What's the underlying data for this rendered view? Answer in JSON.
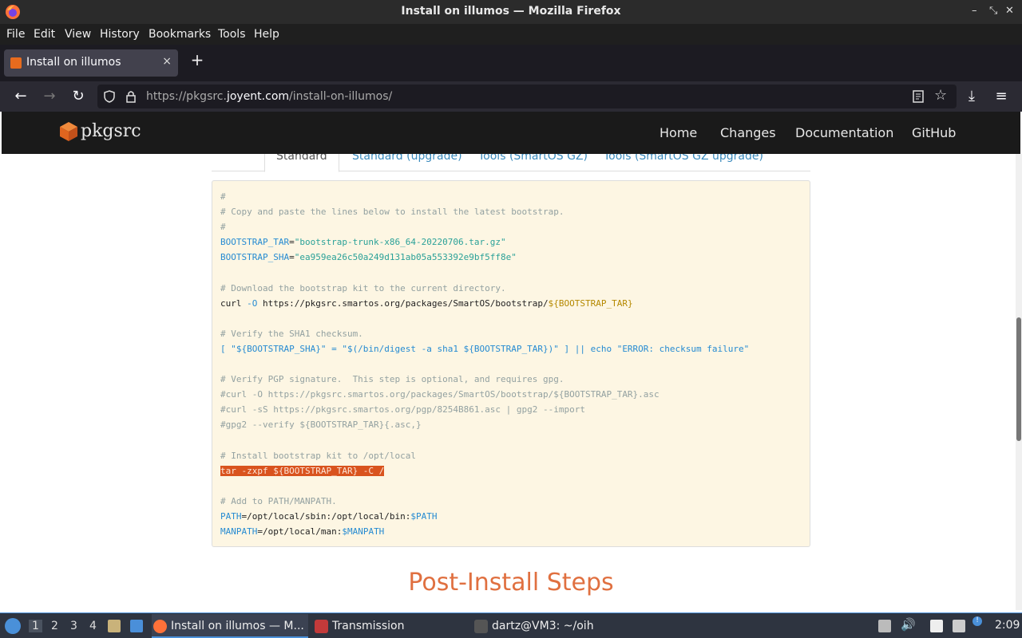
{
  "window": {
    "title": "Install on illumos — Mozilla Firefox"
  },
  "menu": [
    "File",
    "Edit",
    "View",
    "History",
    "Bookmarks",
    "Tools",
    "Help"
  ],
  "tab": {
    "label": "Install on illumos",
    "close": "×",
    "new_tab": "+"
  },
  "urlbar": {
    "prefix": "https://pkgsrc.",
    "domain": "joyent.com",
    "path": "/install-on-illumos/"
  },
  "site": {
    "logo_text": "pkgsrc",
    "nav": [
      "Home",
      "Changes",
      "Documentation",
      "GitHub"
    ]
  },
  "page_tabs": [
    "Standard",
    "Standard (upgrade)",
    "Tools (SmartOS GZ)",
    "Tools (SmartOS GZ upgrade)"
  ],
  "code": {
    "l1": "#",
    "l2": "# Copy and paste the lines below to install the latest bootstrap.",
    "l3": "#",
    "l4_var": "BOOTSTRAP_TAR",
    "l4_val": "\"bootstrap-trunk-x86_64-20220706.tar.gz\"",
    "l5_var": "BOOTSTRAP_SHA",
    "l5_val": "\"ea959ea26c50a249d131ab05a553392e9bf5ff8e\"",
    "l7": "# Download the bootstrap kit to the current directory.",
    "l8_a": "curl ",
    "l8_b": "-O",
    "l8_c": " https://pkgsrc.smartos.org/packages/SmartOS/bootstrap/",
    "l8_d": "${BOOTSTRAP_TAR}",
    "l10": "# Verify the SHA1 checksum.",
    "l11": "[ \"${BOOTSTRAP_SHA}\" = \"$(/bin/digest -a sha1 ${BOOTSTRAP_TAR})\" ] || echo \"ERROR: checksum failure\"",
    "l13": "# Verify PGP signature.  This step is optional, and requires gpg.",
    "l14": "#curl -O https://pkgsrc.smartos.org/packages/SmartOS/bootstrap/${BOOTSTRAP_TAR}.asc",
    "l15": "#curl -sS https://pkgsrc.smartos.org/pgp/8254B861.asc | gpg2 --import",
    "l16": "#gpg2 --verify ${BOOTSTRAP_TAR}{.asc,}",
    "l18": "# Install bootstrap kit to /opt/local",
    "l19": "tar -zxpf ${BOOTSTRAP_TAR} -C /",
    "l21": "# Add to PATH/MANPATH.",
    "l22_var": "PATH",
    "l22_val": "=/opt/local/sbin:/opt/local/bin:",
    "l22_end": "$PATH",
    "l23_var": "MANPATH",
    "l23_val": "=/opt/local/man:",
    "l23_end": "$MANPATH"
  },
  "post_install_title": "Post-Install Steps",
  "taskbar": {
    "workspaces": [
      "1",
      "2",
      "3",
      "4"
    ],
    "tasks": [
      "Install on illumos — M...",
      "Transmission",
      "dartz@VM3: ~/oih"
    ],
    "clock": "2:09"
  },
  "colors": {
    "accent": "#e07040",
    "selection": "#d9531e",
    "code_bg": "#fdf6e3"
  }
}
